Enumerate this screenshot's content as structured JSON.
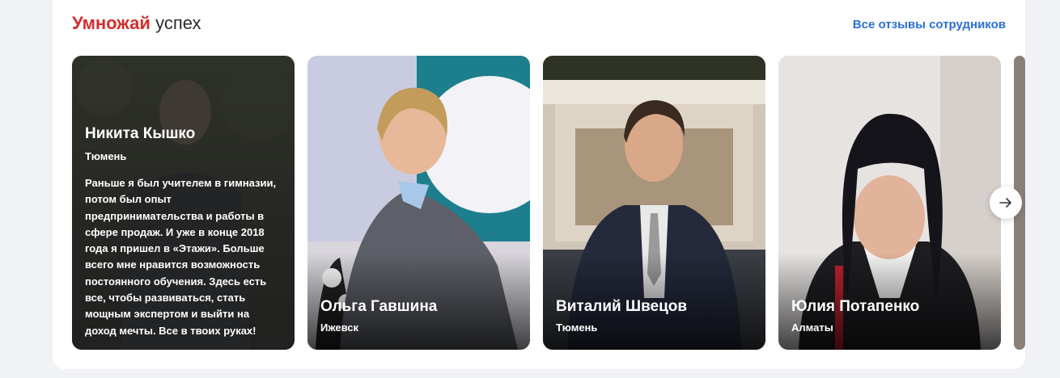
{
  "section": {
    "title_accent": "Умножай",
    "title_rest": "успех",
    "all_reviews_link": "Все отзывы сотрудников"
  },
  "cards": [
    {
      "name": "Никита Кышко",
      "city": "Тюмень",
      "quote": "Раньше я был учителем в гимназии, потом был опыт предпринимательства и работы в сфере продаж. И уже в конце 2018 года я пришел в «Этажи». Больше всего мне нравится возможность постоянного обучения. Здесь есть все, чтобы развиваться, стать мощным экспертом и выйти на доход мечты. Все в твоих руках!"
    },
    {
      "name": "Ольга Гавшина",
      "city": "Ижевск"
    },
    {
      "name": "Виталий Швецов",
      "city": "Тюмень"
    },
    {
      "name": "Юлия Потапенко",
      "city": "Алматы"
    }
  ],
  "carousel": {
    "next_icon": "arrow-right-icon"
  },
  "colors": {
    "accent": "#d22d2d",
    "link": "#2a6fdb",
    "background": "#f1f2f6"
  }
}
